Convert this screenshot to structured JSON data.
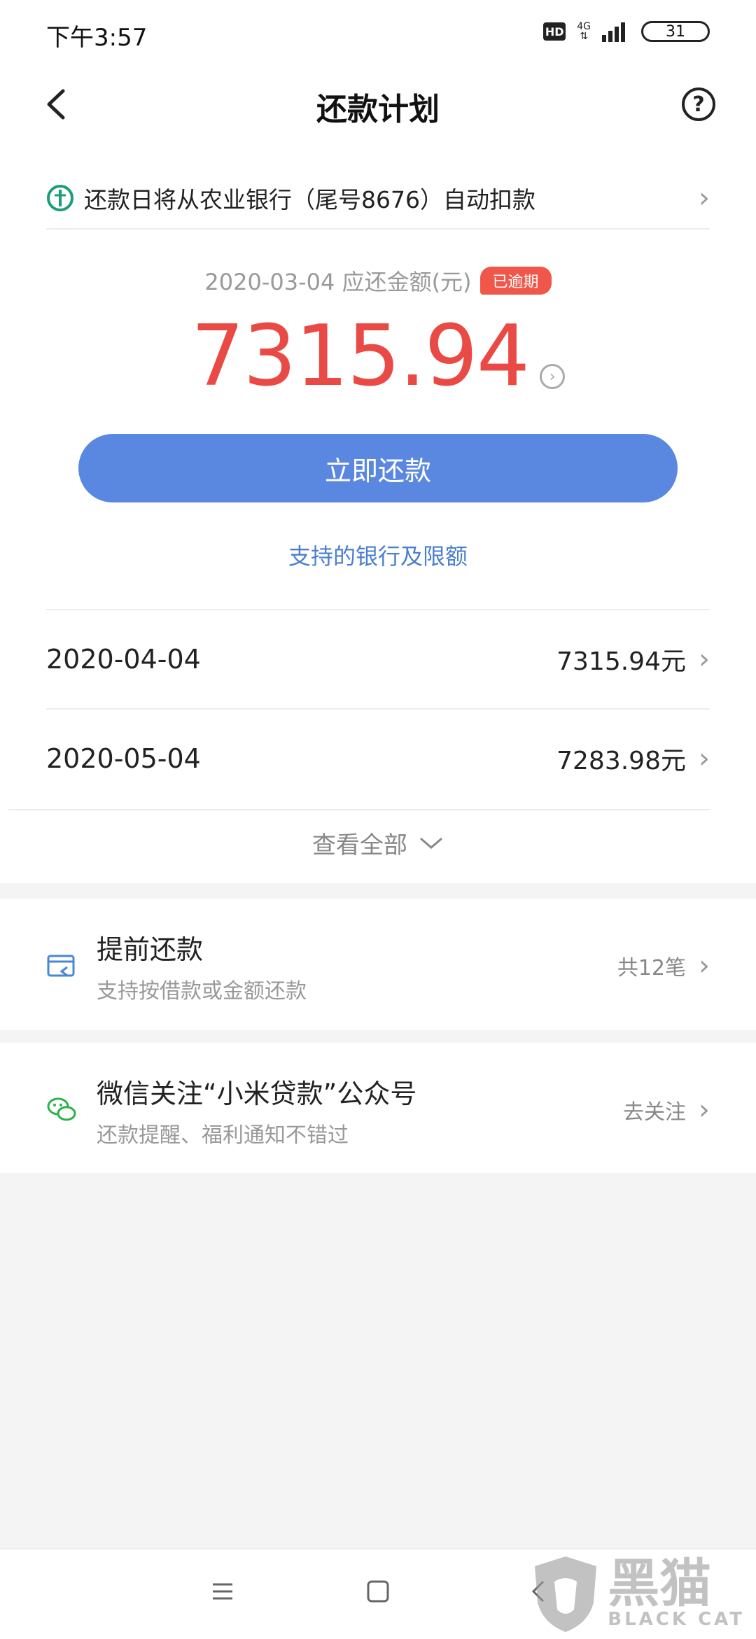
{
  "status_bar": {
    "time": "下午3:57",
    "hd": "HD",
    "network": "4G",
    "battery": "31"
  },
  "header": {
    "title": "还款计划",
    "help": "?"
  },
  "auto_debit": {
    "text": "还款日将从农业银行（尾号8676）自动扣款"
  },
  "due": {
    "label": "2020-03-04 应还金额(元)",
    "badge": "已逾期",
    "amount": "7315.94"
  },
  "repay_button": "立即还款",
  "bank_link": "支持的银行及限额",
  "schedule": [
    {
      "date": "2020-04-04",
      "amount": "7315.94元"
    },
    {
      "date": "2020-05-04",
      "amount": "7283.98元"
    }
  ],
  "view_all": "查看全部",
  "early_repay": {
    "title": "提前还款",
    "subtitle": "支持按借款或金额还款",
    "right": "共12笔"
  },
  "wechat": {
    "title": "微信关注“小米贷款”公众号",
    "subtitle": "还款提醒、福利通知不错过",
    "right": "去关注"
  },
  "watermark": {
    "text": "黑猫",
    "sub": "BLACK CAT"
  },
  "colors": {
    "accent_blue": "#5a88e0",
    "amount_red": "#ea4a45",
    "badge_red": "#f0564a",
    "link_blue": "#4a7fd0"
  }
}
